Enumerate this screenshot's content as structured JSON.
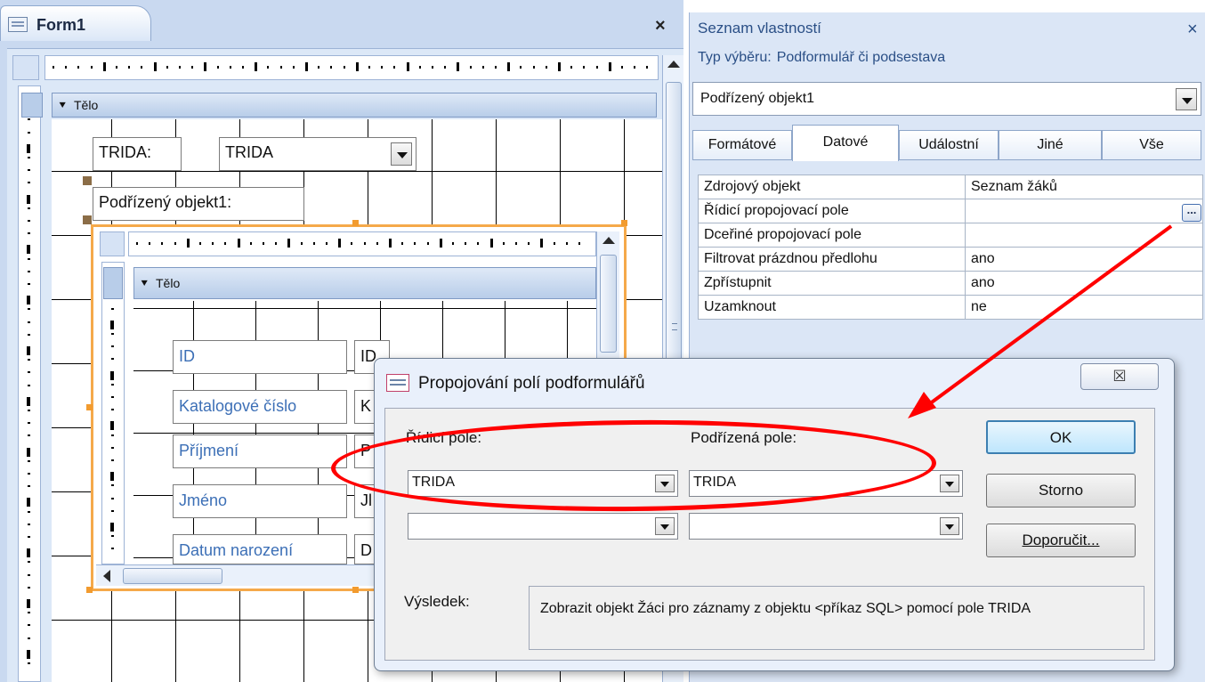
{
  "form_window": {
    "tab_title": "Form1",
    "close_glyph": "×",
    "section_label": "Tělo",
    "section_arrow": "⯆"
  },
  "form_controls": {
    "trida_label": "TRIDA:",
    "trida_combo": "TRIDA",
    "subform_label": "Podřízený objekt1:"
  },
  "subform": {
    "section_label": "Tělo",
    "section_arrow": "⯆",
    "fields": [
      {
        "label": "ID",
        "value": "ID"
      },
      {
        "label": "Katalogové číslo",
        "value": "K"
      },
      {
        "label": "Příjmení",
        "value": "P"
      },
      {
        "label": "Jméno",
        "value": "Jl"
      },
      {
        "label": "Datum narození",
        "value": "D"
      }
    ]
  },
  "property_sheet": {
    "title": "Seznam vlastností",
    "close_glyph": "×",
    "selection_type_label": "Typ výběru:",
    "selection_type_value": "Podformulář či podsestava",
    "object_combo": "Podřízený objekt1",
    "tabs": [
      "Formátové",
      "Datové",
      "Událostní",
      "Jiné",
      "Vše"
    ],
    "active_tab": "Datové",
    "rows": [
      {
        "name": "Zdrojový objekt",
        "value": "Seznam žáků"
      },
      {
        "name": "Řídicí propojovací pole",
        "value": ""
      },
      {
        "name": "Dceřiné propojovací pole",
        "value": ""
      },
      {
        "name": "Filtrovat prázdnou předlohu",
        "value": "ano"
      },
      {
        "name": "Zpřístupnit",
        "value": "ano"
      },
      {
        "name": "Uzamknout",
        "value": "ne"
      }
    ],
    "builder_button": "..."
  },
  "dialog": {
    "title": "Propojování polí podformulářů",
    "close_glyph": "☒",
    "master_label": "Řídicí pole:",
    "child_label": "Podřízená pole:",
    "master_field_1": "TRIDA",
    "child_field_1": "TRIDA",
    "master_field_2": "",
    "child_field_2": "",
    "ok_label": "OK",
    "cancel_label": "Storno",
    "suggest_label": "Doporučit...",
    "result_label": "Výsledek:",
    "result_text": "Zobrazit objekt Žáci pro záznamy z objektu <příkaz SQL> pomocí pole TRIDA"
  },
  "colors": {
    "annotation": "#ff0000",
    "label_text": "#3c6fb6",
    "selection_handle": "#f29b2f"
  }
}
